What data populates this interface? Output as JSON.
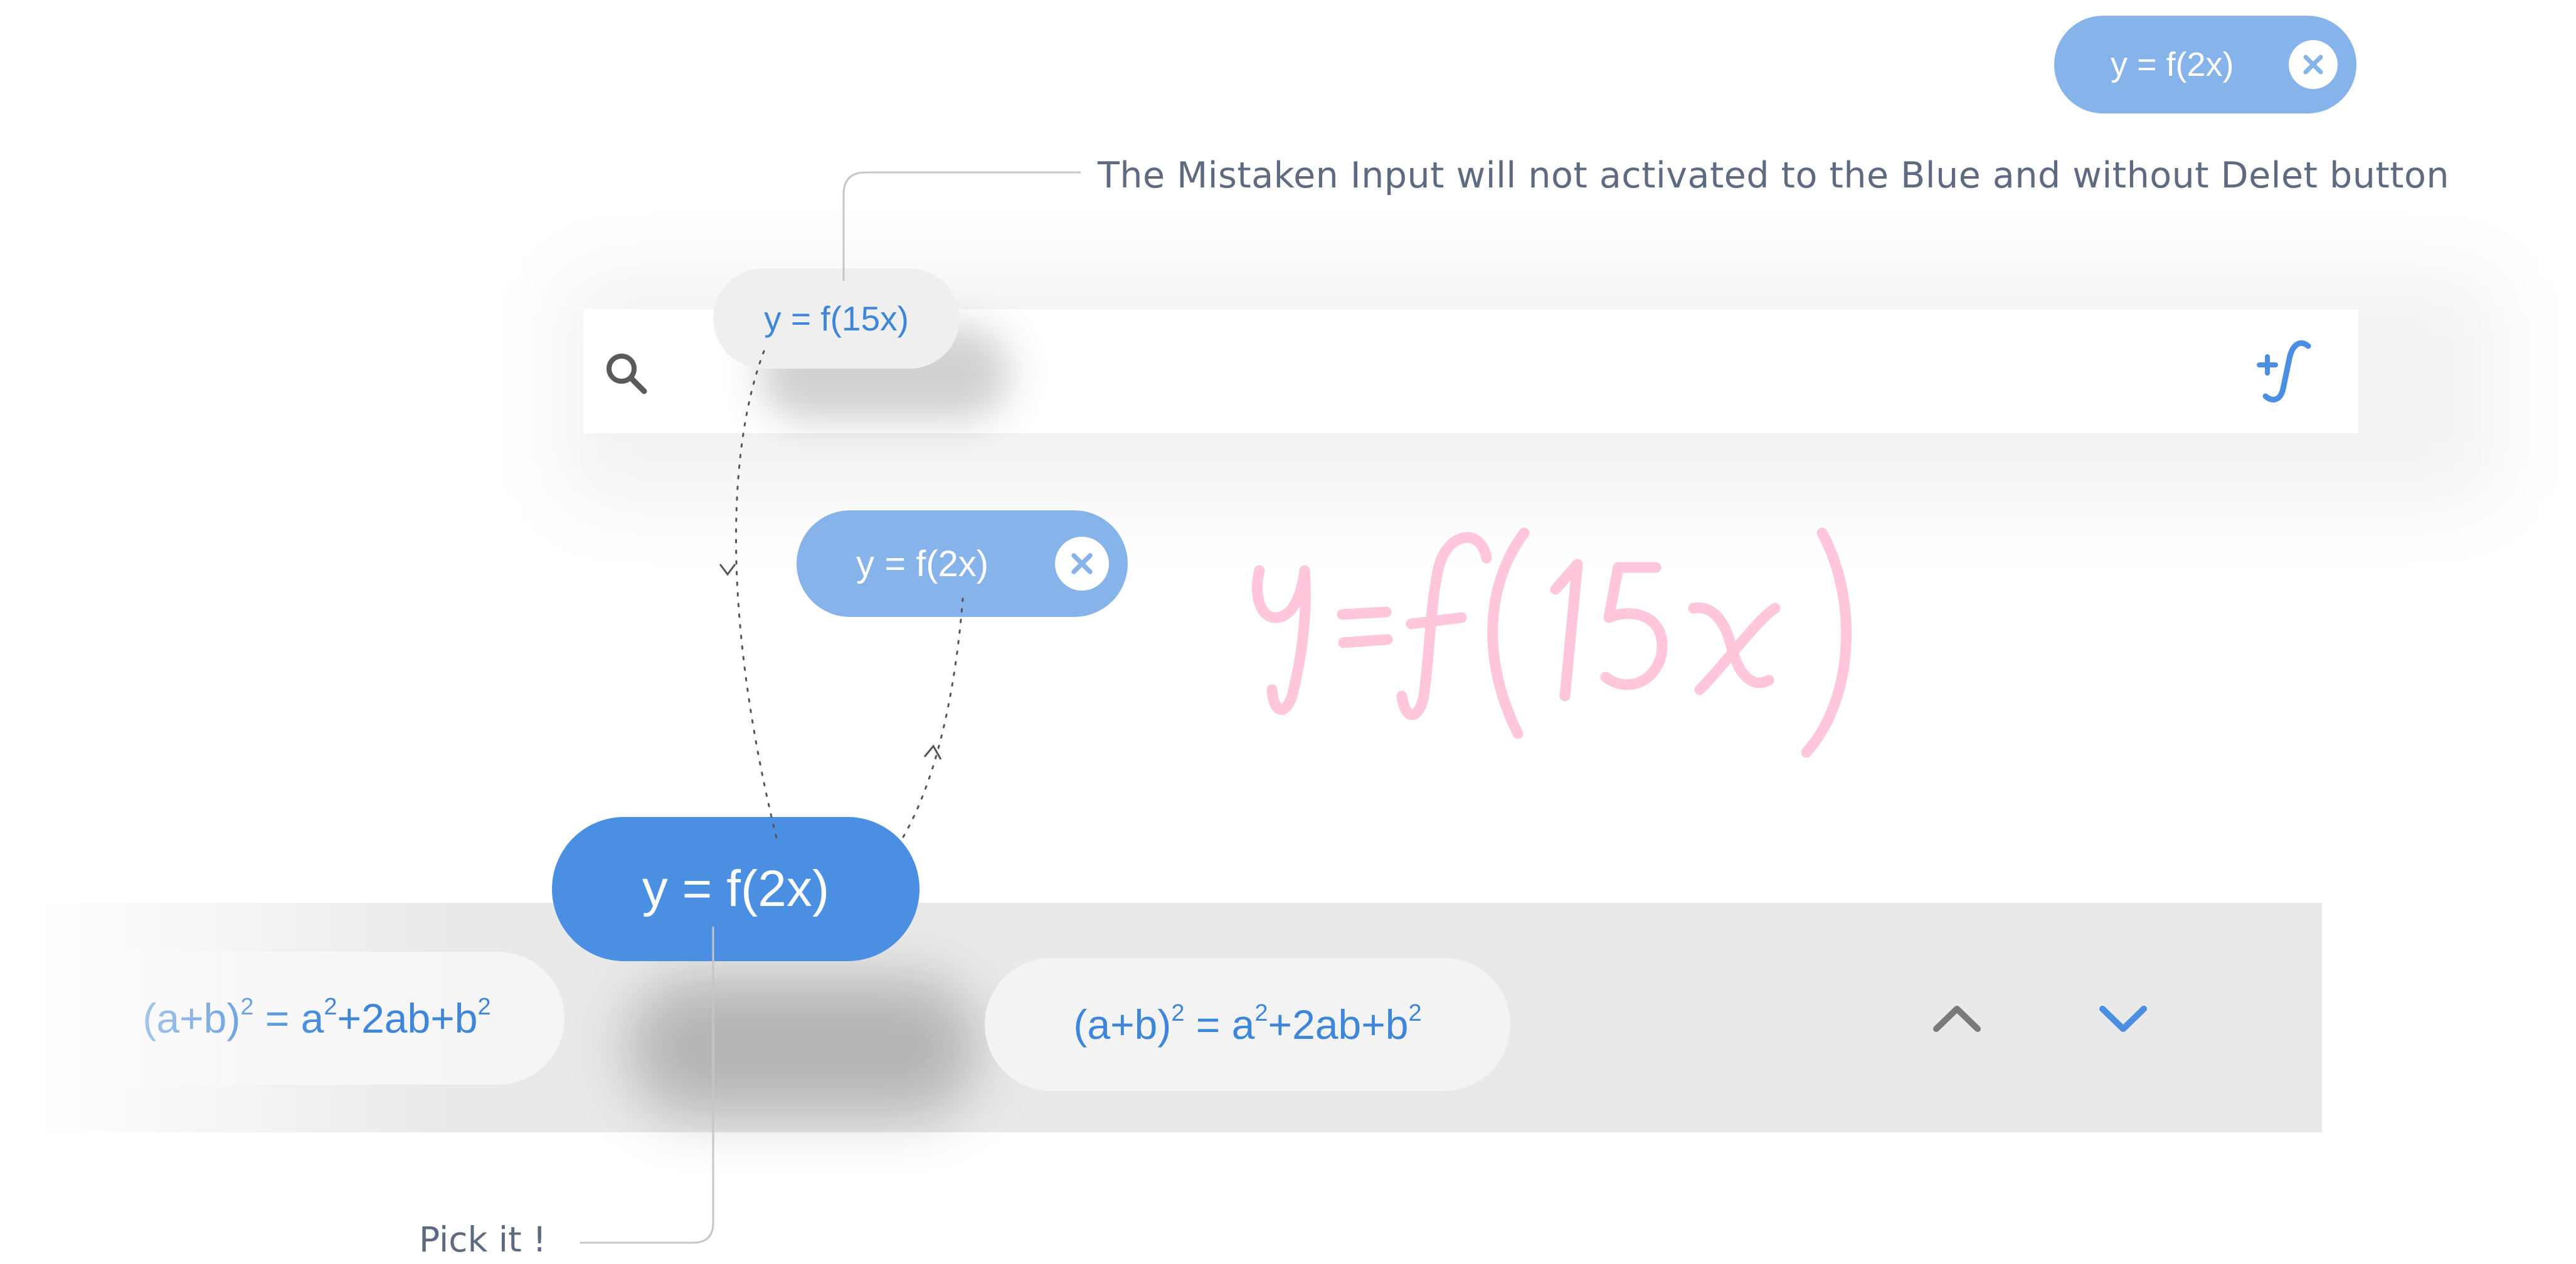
{
  "annotations": {
    "top_note": "The Mistaken Input will not activated to the Blue and without Delet button",
    "bottom_note": "Pick it !"
  },
  "chips": {
    "top_right": {
      "label": "y = f(2x)",
      "close_icon": "close-icon"
    },
    "mistaken": {
      "label": "y = f(15x)"
    },
    "middle": {
      "label": "y = f(2x)",
      "close_icon": "close-icon"
    },
    "picked": {
      "label": "y = f(2x)"
    }
  },
  "search": {
    "icon": "search-icon",
    "function_icon": "add-function-icon"
  },
  "handwriting": {
    "text": "y = f(15x)"
  },
  "formulas": {
    "left": {
      "base": "(a+b)",
      "exp1": "2",
      "eq": " = a",
      "exp2": "2",
      "rest": "+2ab+b",
      "exp3": "2"
    },
    "right": {
      "base": "(a+b)",
      "exp1": "2",
      "eq": " = a",
      "exp2": "2",
      "rest": "+2ab+b",
      "exp3": "2"
    }
  },
  "navigation": {
    "up_icon": "chevron-up-icon",
    "down_icon": "chevron-down-icon"
  },
  "colors": {
    "primary_blue": "#4a8fe2",
    "light_blue": "#86b3ea",
    "text_blue": "#3d86d9",
    "handwriting_pink": "#ffc6dc",
    "annotation_gray": "#5d6a80",
    "strip_gray": "#e9e9e9"
  }
}
